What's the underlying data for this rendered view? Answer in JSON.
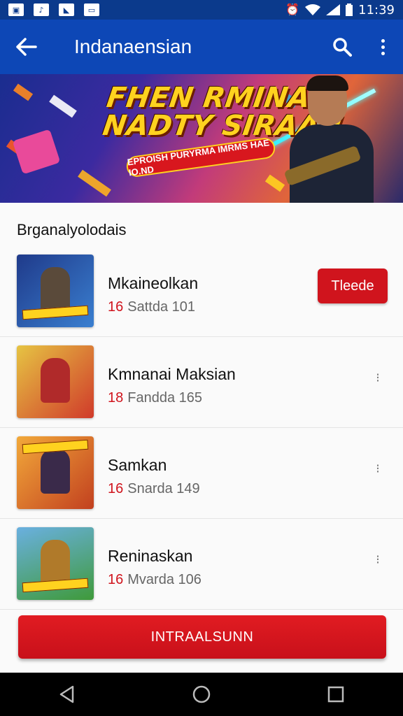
{
  "status_bar": {
    "time": "11:39",
    "notification_icons": [
      "gallery-icon",
      "music-icon",
      "image-icon",
      "wallet-icon"
    ],
    "system_icons": [
      "alarm-icon",
      "wifi-icon",
      "signal-icon",
      "battery-icon"
    ]
  },
  "app_bar": {
    "title": "Indanaensian",
    "background_color": "#0d47b6"
  },
  "banner": {
    "headline_line1": "FHEN RMINAN",
    "headline_line2": "NADTY SIRAAI!",
    "ribbon_text": "EPROISH PURYRMA IMRMS HAE IO.ND"
  },
  "list": {
    "section_title": "Brganalyolodais",
    "items": [
      {
        "title": "Mkaineolkan",
        "number": "16",
        "meta": "Sattda 101",
        "action": "Tleede",
        "thumb_color": "#1f3a8a"
      },
      {
        "title": "Kmnanai Maksian",
        "number": "18",
        "meta": "Fandda 165",
        "action": "",
        "thumb_color": "#e6c443"
      },
      {
        "title": "Samkan",
        "number": "16",
        "meta": "Snarda 149",
        "action": "",
        "thumb_color": "#e0762a"
      },
      {
        "title": "Reninaskan",
        "number": "16",
        "meta": "Mvarda 106",
        "action": "",
        "thumb_color": "#3f9a3a"
      }
    ]
  },
  "cta": {
    "label": "INTRAALSUNN",
    "color": "#d0141d"
  }
}
